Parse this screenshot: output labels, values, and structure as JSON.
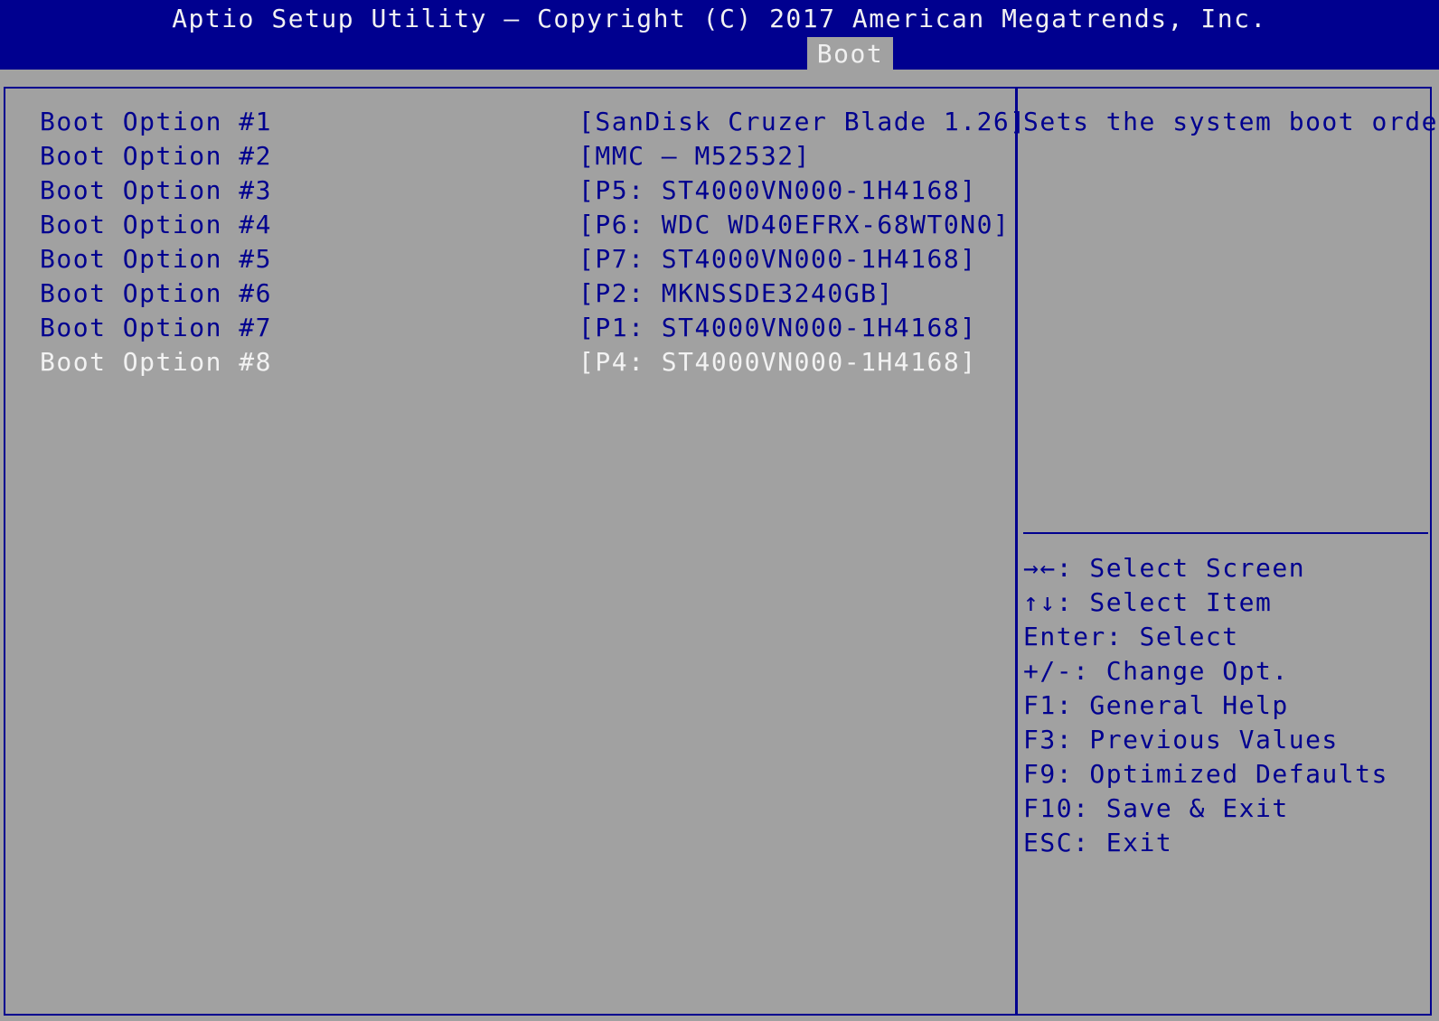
{
  "header": {
    "title": "Aptio Setup Utility – Copyright (C) 2017 American Megatrends, Inc.",
    "active_tab": "Boot"
  },
  "boot_options": [
    {
      "label": "Boot Option #1",
      "value": "[SanDisk Cruzer Blade 1.26]"
    },
    {
      "label": "Boot Option #2",
      "value": "[MMC – M52532]"
    },
    {
      "label": "Boot Option #3",
      "value": "[P5: ST4000VN000-1H4168]"
    },
    {
      "label": "Boot Option #4",
      "value": "[P6: WDC WD40EFRX-68WT0N0]"
    },
    {
      "label": "Boot Option #5",
      "value": "[P7: ST4000VN000-1H4168]"
    },
    {
      "label": "Boot Option #6",
      "value": "[P2: MKNSSDE3240GB]"
    },
    {
      "label": "Boot Option #7",
      "value": "[P1: ST4000VN000-1H4168]"
    },
    {
      "label": "Boot Option #8",
      "value": "[P4: ST4000VN000-1H4168]"
    }
  ],
  "selected_index": 7,
  "help_text": "Sets the system boot order",
  "key_help": [
    "→←: Select Screen",
    "↑↓: Select Item",
    "Enter: Select",
    "+/-: Change Opt.",
    "F1: General Help",
    "F3: Previous Values",
    "F9: Optimized Defaults",
    "F10: Save & Exit",
    "ESC: Exit"
  ],
  "colors": {
    "bios_blue": "#00008f",
    "background_gray": "#a1a1a1",
    "highlight_white": "#f2f2f2"
  }
}
